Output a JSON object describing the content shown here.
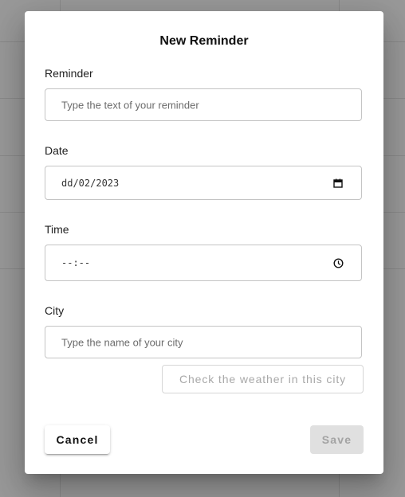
{
  "dialog": {
    "title": "New Reminder"
  },
  "fields": {
    "reminder": {
      "label": "Reminder",
      "placeholder": "Type the text of your reminder"
    },
    "date": {
      "label": "Date",
      "value": "dd/02/2023",
      "icon": "calendar-icon"
    },
    "time": {
      "label": "Time",
      "value": "--:--",
      "icon": "clock-icon"
    },
    "city": {
      "label": "City",
      "placeholder": "Type the name of your city"
    }
  },
  "actions": {
    "weather_label": "Check the weather in this city",
    "cancel_label": "Cancel",
    "save_label": "Save"
  },
  "colors": {
    "backdrop": "#999999",
    "dialog_bg": "#ffffff",
    "disabled_bg": "#e0e0e0",
    "disabled_text": "#a3a3a3"
  }
}
